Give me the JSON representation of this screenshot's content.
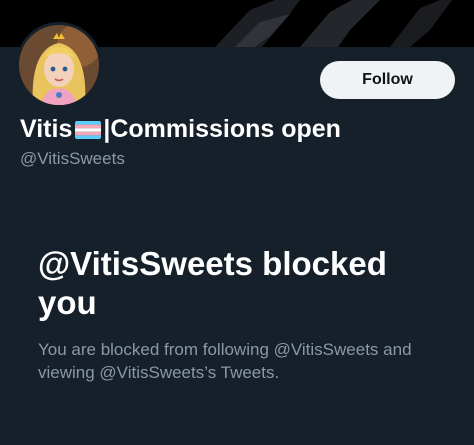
{
  "profile": {
    "display_name_prefix": "Vitis",
    "display_name_suffix": "|Commissions open",
    "handle": "@VitisSweets",
    "flag_icon": "trans-pride-flag-icon",
    "avatar_icon": "profile-avatar"
  },
  "actions": {
    "follow_label": "Follow"
  },
  "blocked": {
    "title": "@VitisSweets blocked you",
    "description": "You are blocked from following @VitisSweets and viewing @VitisSweets’s Tweets."
  },
  "colors": {
    "background": "#15202b",
    "banner": "#000000",
    "follow_button_bg": "#eff3f4",
    "muted_text": "#8b98a5"
  }
}
